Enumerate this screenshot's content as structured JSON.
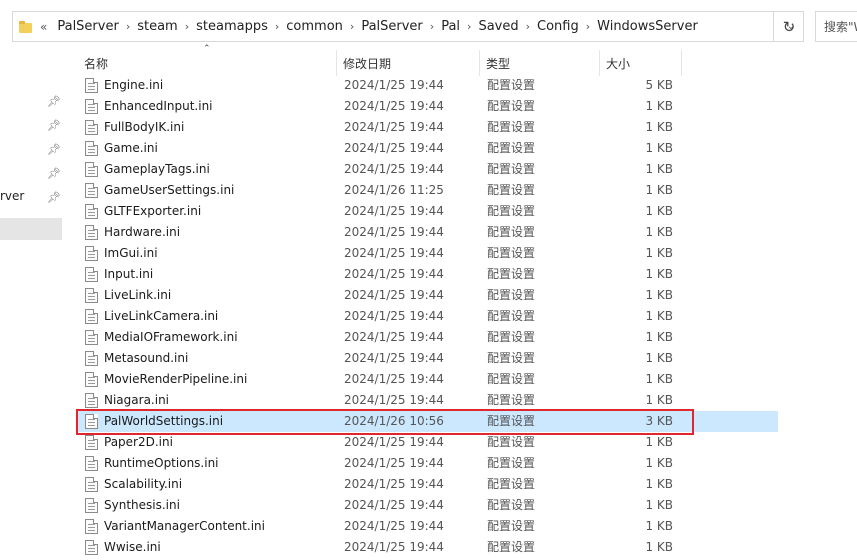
{
  "addressbar": {
    "more": "«",
    "crumbs": [
      "PalServer",
      "steam",
      "steamapps",
      "common",
      "PalServer",
      "Pal",
      "Saved",
      "Config",
      "WindowsServer"
    ],
    "search_placeholder": "搜索\"W"
  },
  "nav": {
    "partial_item": "rver"
  },
  "columns": {
    "name": "名称",
    "date": "修改日期",
    "type": "类型",
    "size": "大小"
  },
  "files": [
    {
      "name": "Engine.ini",
      "date": "2024/1/25 19:44",
      "type": "配置设置",
      "size": "5 KB"
    },
    {
      "name": "EnhancedInput.ini",
      "date": "2024/1/25 19:44",
      "type": "配置设置",
      "size": "1 KB"
    },
    {
      "name": "FullBodyIK.ini",
      "date": "2024/1/25 19:44",
      "type": "配置设置",
      "size": "1 KB"
    },
    {
      "name": "Game.ini",
      "date": "2024/1/25 19:44",
      "type": "配置设置",
      "size": "1 KB"
    },
    {
      "name": "GameplayTags.ini",
      "date": "2024/1/25 19:44",
      "type": "配置设置",
      "size": "1 KB"
    },
    {
      "name": "GameUserSettings.ini",
      "date": "2024/1/26 11:25",
      "type": "配置设置",
      "size": "1 KB"
    },
    {
      "name": "GLTFExporter.ini",
      "date": "2024/1/25 19:44",
      "type": "配置设置",
      "size": "1 KB"
    },
    {
      "name": "Hardware.ini",
      "date": "2024/1/25 19:44",
      "type": "配置设置",
      "size": "1 KB"
    },
    {
      "name": "ImGui.ini",
      "date": "2024/1/25 19:44",
      "type": "配置设置",
      "size": "1 KB"
    },
    {
      "name": "Input.ini",
      "date": "2024/1/25 19:44",
      "type": "配置设置",
      "size": "1 KB"
    },
    {
      "name": "LiveLink.ini",
      "date": "2024/1/25 19:44",
      "type": "配置设置",
      "size": "1 KB"
    },
    {
      "name": "LiveLinkCamera.ini",
      "date": "2024/1/25 19:44",
      "type": "配置设置",
      "size": "1 KB"
    },
    {
      "name": "MediaIOFramework.ini",
      "date": "2024/1/25 19:44",
      "type": "配置设置",
      "size": "1 KB"
    },
    {
      "name": "Metasound.ini",
      "date": "2024/1/25 19:44",
      "type": "配置设置",
      "size": "1 KB"
    },
    {
      "name": "MovieRenderPipeline.ini",
      "date": "2024/1/25 19:44",
      "type": "配置设置",
      "size": "1 KB"
    },
    {
      "name": "Niagara.ini",
      "date": "2024/1/25 19:44",
      "type": "配置设置",
      "size": "1 KB"
    },
    {
      "name": "PalWorldSettings.ini",
      "date": "2024/1/26 10:56",
      "type": "配置设置",
      "size": "3 KB",
      "selected": true
    },
    {
      "name": "Paper2D.ini",
      "date": "2024/1/25 19:44",
      "type": "配置设置",
      "size": "1 KB"
    },
    {
      "name": "RuntimeOptions.ini",
      "date": "2024/1/25 19:44",
      "type": "配置设置",
      "size": "1 KB"
    },
    {
      "name": "Scalability.ini",
      "date": "2024/1/25 19:44",
      "type": "配置设置",
      "size": "1 KB"
    },
    {
      "name": "Synthesis.ini",
      "date": "2024/1/25 19:44",
      "type": "配置设置",
      "size": "1 KB"
    },
    {
      "name": "VariantManagerContent.ini",
      "date": "2024/1/25 19:44",
      "type": "配置设置",
      "size": "1 KB"
    },
    {
      "name": "Wwise.ini",
      "date": "2024/1/25 19:44",
      "type": "配置设置",
      "size": "1 KB"
    }
  ],
  "colors": {
    "selection": "#cce8ff",
    "highlight_box": "#e0262e",
    "folder": "#f3cf5b"
  },
  "icons": {
    "folder": "folder-icon",
    "file": "ini-file-icon",
    "pin": "pin-icon",
    "refresh": "refresh-icon",
    "dropdown": "chevron-down-icon"
  }
}
